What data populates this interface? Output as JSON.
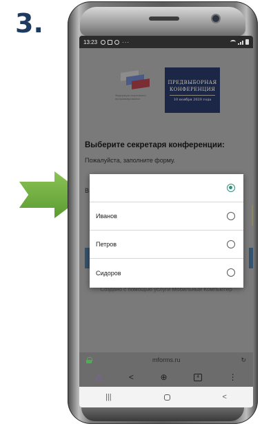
{
  "step_label": "3.",
  "status_bar": {
    "time": "13:23",
    "dots": "···"
  },
  "banner": {
    "logo_text": "Федерация спортивного программирования",
    "line1": "ПРЕДВЫБОРНАЯ",
    "line2": "КОНФЕРЕНЦИЯ",
    "line3": "10 ноября 2020 года"
  },
  "form": {
    "title": "Выберите секретаря конференции:",
    "subtitle": "Пожалуйста, заполните форму.",
    "label_partial": "В",
    "footer": "Создано с помощью услуги Мобильный Компьютер"
  },
  "popup": {
    "options": [
      {
        "label": "",
        "checked": true
      },
      {
        "label": "Иванов",
        "checked": false
      },
      {
        "label": "Петров",
        "checked": false
      },
      {
        "label": "Сидоров",
        "checked": false
      }
    ]
  },
  "browser": {
    "url": "mforms.ru",
    "reload": "↻",
    "tab_count": "4"
  },
  "toolbar": {
    "home": "△",
    "share": "<",
    "add": "⊕",
    "menu": "⋮"
  },
  "navbar": {
    "recents": "|||",
    "back": "<"
  },
  "colors": {
    "arrow_fill": "#6fae3f",
    "accent": "#2f8f7a",
    "banner_bg": "#1c2647"
  }
}
